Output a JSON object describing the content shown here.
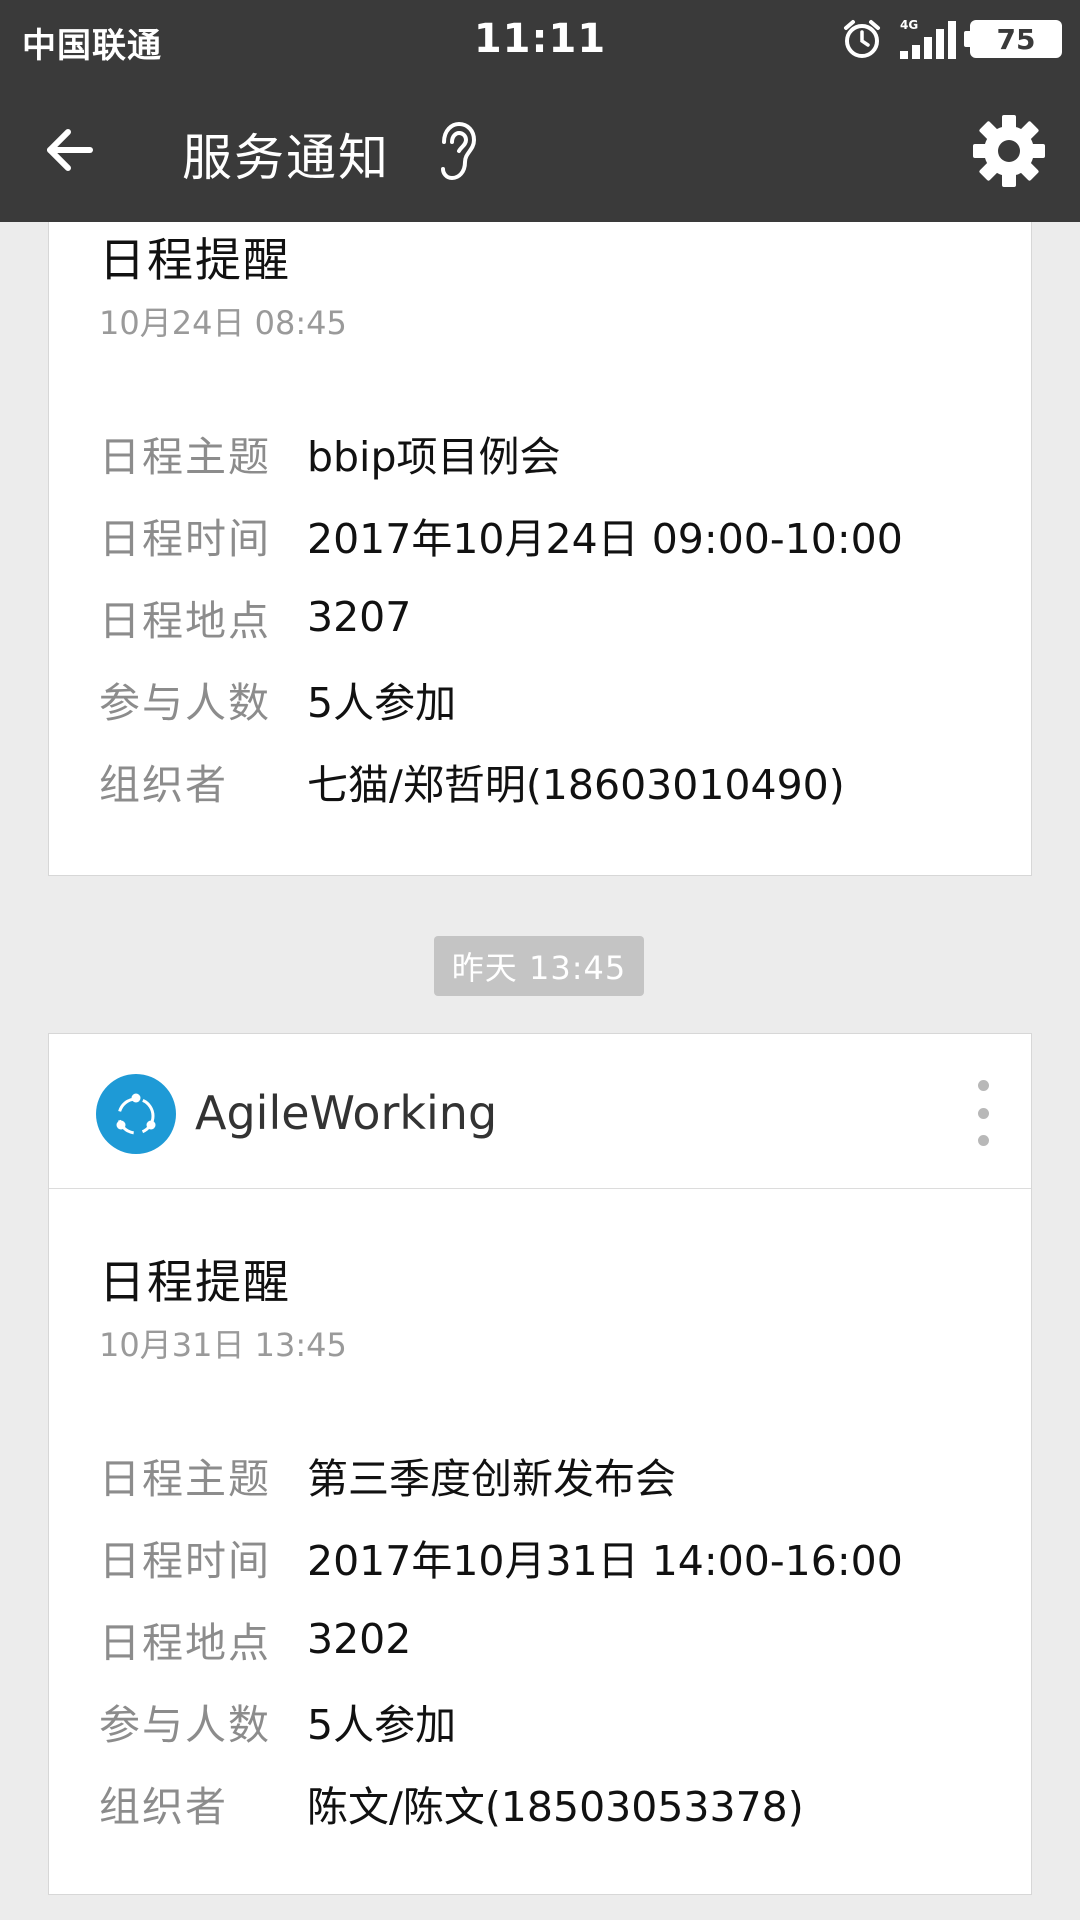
{
  "status_bar": {
    "carrier": "中国联通",
    "time": "11:11",
    "network": "4G",
    "battery": "75"
  },
  "app_bar": {
    "title": "服务通知"
  },
  "card1": {
    "title": "日程提醒",
    "time": "10月24日  08:45",
    "rows": [
      {
        "label": "日程主题",
        "value": "bbip项目例会"
      },
      {
        "label": "日程时间",
        "value": "2017年10月24日 09:00-10:00"
      },
      {
        "label": "日程地点",
        "value": "3207"
      },
      {
        "label": "参与人数",
        "value": "5人参加"
      },
      {
        "label": "组织者",
        "value": "七猫/郑哲明(18603010490)"
      }
    ]
  },
  "timestamp": "昨天 13:45",
  "card2": {
    "sender": "AgileWorking",
    "title": "日程提醒",
    "time": "10月31日  13:45",
    "rows": [
      {
        "label": "日程主题",
        "value": "第三季度创新发布会"
      },
      {
        "label": "日程时间",
        "value": "2017年10月31日 14:00-16:00"
      },
      {
        "label": "日程地点",
        "value": "3202"
      },
      {
        "label": "参与人数",
        "value": "5人参加"
      },
      {
        "label": "组织者",
        "value": "陈文/陈文(18503053378)"
      }
    ]
  },
  "colors": {
    "bar_background": "#3a3a3a",
    "avatar_blue": "#1e9ad6",
    "page_background": "#ececec"
  },
  "icons": [
    "back-arrow-icon",
    "ear-icon",
    "gear-icon",
    "alarm-icon",
    "signal-icon",
    "battery-icon",
    "more-vertical-icon"
  ]
}
